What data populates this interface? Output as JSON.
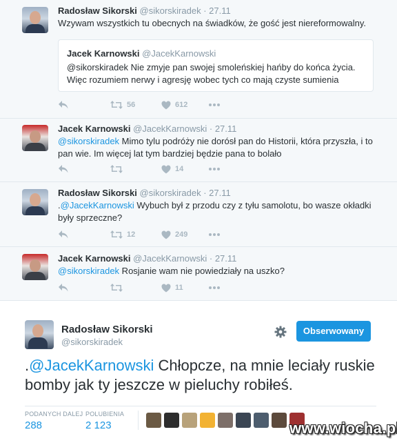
{
  "thread": [
    {
      "name": "Radosław Sikorski",
      "handle": "@sikorskiradek",
      "date": "· 27.11",
      "text": "Wzywam wszystkich tu obecnych na świadków, że gość jest niereformowalny.",
      "quote": {
        "name": "Jacek Karnowski",
        "handle": "@JacekKarnowski",
        "text": "@sikorskiradek Nie zmyje pan swojej smoleńskiej hańby do końca życia. Więc rozumiem nerwy i agresję wobec tych co mają czyste sumienia"
      },
      "retweets": "56",
      "likes": "612"
    },
    {
      "name": "Jacek Karnowski",
      "handle": "@JacekKarnowski",
      "date": "· 27.11",
      "mention": "@sikorskiradek",
      "text": " Mimo tylu podróży nie dorósł pan do Historii, która przyszła, i to pan wie. Im więcej lat tym bardziej będzie pana to bolało",
      "retweets": "",
      "likes": "14"
    },
    {
      "name": "Radosław Sikorski",
      "handle": "@sikorskiradek",
      "date": "· 27.11",
      "prefix": ".",
      "mention": "@JacekKarnowski",
      "text": " Wybuch był z przodu czy z tyłu samolotu, bo wasze okładki były sprzeczne?",
      "retweets": "12",
      "likes": "249"
    },
    {
      "name": "Jacek Karnowski",
      "handle": "@JacekKarnowski",
      "date": "· 27.11",
      "mention": "@sikorskiradek",
      "text": " Rosjanie wam nie powiedziały na uszko?",
      "retweets": "",
      "likes": "11"
    }
  ],
  "main_tweet": {
    "name": "Radosław Sikorski",
    "handle": "@sikorskiradek",
    "follow_label": "Obserwowany",
    "prefix": ".",
    "mention": "@JacekKarnowski",
    "text": " Chłopcze, na mnie leciały ruskie bomby jak ty jeszcze w pieluchy robiłeś.",
    "retweets_label": "PODANYCH DALEJ",
    "retweets": "288",
    "likes_label": "POLUBIENIA",
    "likes": "2 123",
    "liker_colors": [
      "#6b5a44",
      "#2d2d2d",
      "#b8a27a",
      "#f2b233",
      "#7d6f69",
      "#3b4654",
      "#4d5d6e",
      "#5c4a3c",
      "#9e3030"
    ]
  },
  "icons": {
    "reply": "reply-icon",
    "retweet": "retweet-icon",
    "like": "heart-icon",
    "more": "more-icon",
    "settings": "gear-icon"
  },
  "watermark": "www.wiocha.pl",
  "colors": {
    "link": "#1b95e0",
    "muted": "#8899a6",
    "icon": "#aab8c2",
    "thread_bg": "#f5f8fa"
  }
}
